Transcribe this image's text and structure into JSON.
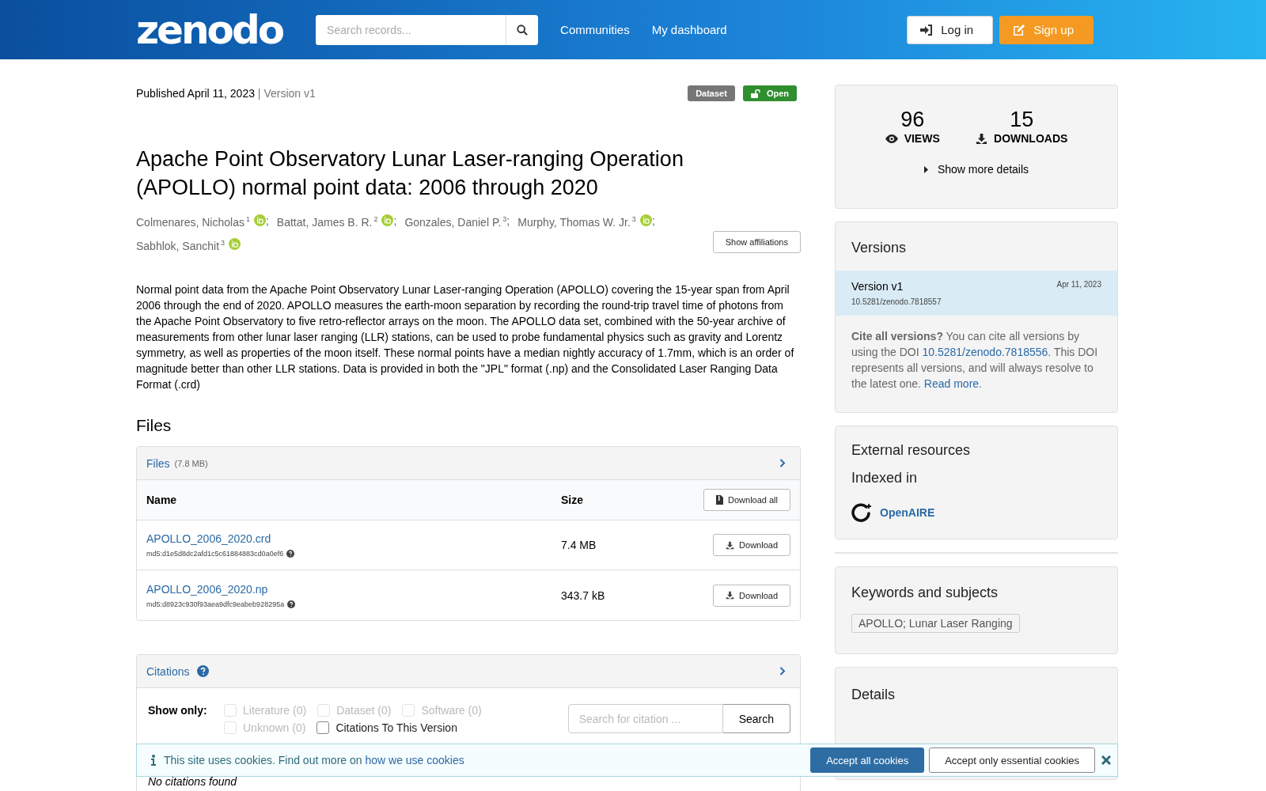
{
  "header": {
    "logo": "zenodo",
    "search": {
      "placeholder": "Search records..."
    },
    "nav": [
      "Communities",
      "My dashboard"
    ],
    "login": "Log in",
    "signup": "Sign up"
  },
  "record": {
    "published": "Published April 11, 2023",
    "version_separator": "|",
    "version": "Version v1",
    "creator_separator": ";",
    "badges": [
      {
        "label": "Dataset",
        "kind": "type"
      },
      {
        "label": "Open",
        "kind": "access"
      }
    ],
    "title": "Apache Point Observatory Lunar Laser-ranging Operation (APOLLO) normal point data: 2006 through 2020",
    "creators": [
      {
        "name": "Colmenares, Nicholas",
        "affiliation": "1",
        "orcid": true
      },
      {
        "name": "Battat, James B. R.",
        "affiliation": "2",
        "orcid": true
      },
      {
        "name": "Gonzales, Daniel P.",
        "affiliation": "3",
        "orcid": false
      },
      {
        "name": "Murphy, Thomas W. Jr.",
        "affiliation": "3",
        "orcid": true
      },
      {
        "name": "Sabhlok, Sanchit",
        "affiliation": "3",
        "orcid": true
      }
    ],
    "show_affiliations": "Show affiliations",
    "description": "Normal point data from the Apache Point Observatory Lunar Laser-ranging Operation (APOLLO) covering the 15-year span from April 2006 through the end of 2020. APOLLO measures the earth-moon separation by recording the round-trip travel time of photons from the Apache Point Observatory to five retro-reflector arrays on the moon. The APOLLO data set, combined with the 50-year archive of measurements from other lunar laser ranging (LLR) stations, can be used to probe fundamental physics such as gravity and Lorentz symmetry, as well as properties of the moon itself. These normal points have a median nightly accuracy of 1.7mm, which is an order of magnitude better than other LLR stations. Data is provided in both the \"JPL\" format (.np) and the Consolidated Laser Ranging Data Format (.crd)"
  },
  "files": {
    "heading": "Files",
    "panel_title": "Files",
    "total_size": "(7.8 MB)",
    "columns": [
      "Name",
      "Size"
    ],
    "download_all": "Download all",
    "rows": [
      {
        "name": "APOLLO_2006_2020.crd",
        "checksum": "md5:d1e5d8dc2afd1c5c61884883cd0a0ef6",
        "size": "7.4 MB",
        "action": "Download"
      },
      {
        "name": "APOLLO_2006_2020.np",
        "checksum": "md5:d8923c930f93aea9dfc9eabeb928295a",
        "size": "343.7 kB",
        "action": "Download"
      }
    ]
  },
  "citations": {
    "title": "Citations",
    "show_only": "Show only:",
    "filters": [
      {
        "label": "Literature (0)",
        "checked": false,
        "disabled": true
      },
      {
        "label": "Dataset (0)",
        "checked": false,
        "disabled": true
      },
      {
        "label": "Software (0)",
        "checked": false,
        "disabled": true
      },
      {
        "label": "Unknown (0)",
        "checked": false,
        "disabled": true
      },
      {
        "label": "Citations To This Version",
        "checked": false,
        "disabled": false
      }
    ],
    "search": {
      "placeholder": "Search for citation ..."
    },
    "search_button": "Search",
    "empty": "No citations found"
  },
  "sidebar": {
    "stats": [
      {
        "value": "96",
        "label": "VIEWS",
        "kind": "views"
      },
      {
        "value": "15",
        "label": "DOWNLOADS",
        "kind": "downloads"
      }
    ],
    "more_details": "Show more details",
    "versions": {
      "title": "Versions",
      "items": [
        {
          "label": "Version v1",
          "date": "Apr 11, 2023",
          "doi": "10.5281/zenodo.7818557",
          "selected": true
        }
      ],
      "cite_lead": "Cite all versions?",
      "cite_text": " You can cite all versions by using the DOI ",
      "cite_doi": "10.5281/zenodo.7818556",
      "cite_text_2": ". This DOI represents all versions, and will always resolve to the latest one. ",
      "read_more": "Read more",
      "cite_end": "."
    },
    "external": {
      "title": "External resources",
      "indexed_in": "Indexed in",
      "resources": [
        "OpenAIRE"
      ]
    },
    "keywords": {
      "title": "Keywords and subjects",
      "tags": [
        "APOLLO; Lunar Laser Ranging"
      ]
    },
    "details": {
      "title": "Details"
    }
  },
  "cookie_banner": {
    "text": "This site uses cookies. Find out more on ",
    "link": "how we use cookies",
    "accept_all": "Accept all cookies",
    "accept_essential": "Accept only essential cookies"
  }
}
